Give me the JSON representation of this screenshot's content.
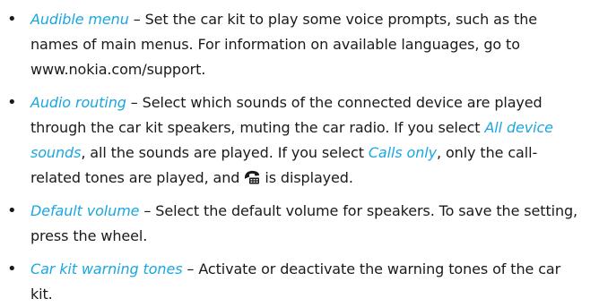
{
  "items": [
    {
      "bullet": "•",
      "term": "Audible menu",
      "dash": " – ",
      "text": "Set the car kit to play some voice prompts, such as the names of main menus. For information on available languages, go to www.nokia.com/support."
    },
    {
      "bullet": "•",
      "term": "Audio routing",
      "dash": " – ",
      "text1": "Select which sounds of the connected device are played through the car kit speakers, muting the car radio. If you select ",
      "option1": "All device sounds",
      "text2": ", all the sounds are played. If you select ",
      "option2": "Calls only",
      "text3": ", only the call-related tones are played, and ",
      "icon": "phone-handset-icon",
      "text4": " is displayed."
    },
    {
      "bullet": "•",
      "term": "Default volume",
      "dash": " – ",
      "text": "Select the default volume for speakers. To save the setting, press the wheel."
    },
    {
      "bullet": "•",
      "term": "Car kit warning tones",
      "dash": " – ",
      "text": "Activate or deactivate the warning tones of the car kit."
    }
  ],
  "colors": {
    "term": "#1aa7e0",
    "body": "#1a1a1a"
  }
}
